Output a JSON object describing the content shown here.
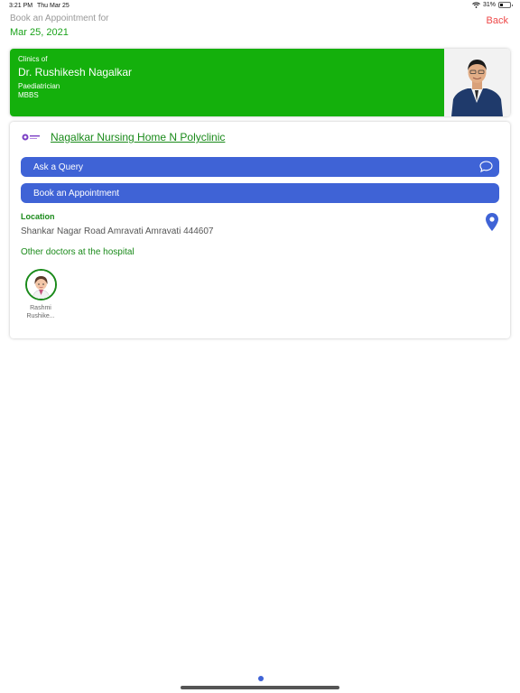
{
  "status_bar": {
    "time": "3:21 PM",
    "date": "Thu Mar 25",
    "battery": "31%",
    "battery_level": 0.31
  },
  "header": {
    "prompt": "Book an Appointment for",
    "date": "Mar 25, 2021",
    "back_label": "Back"
  },
  "doctor": {
    "clinics_of_label": "Clinics of",
    "name": "Dr. Rushikesh Nagalkar",
    "speciality": "Paediatrician",
    "degree": "MBBS"
  },
  "clinic": {
    "name": "Nagalkar Nursing Home N Polyclinic",
    "ask_query_label": "Ask a Query",
    "book_label": "Book an Appointment",
    "location_title": "Location",
    "address": "Shankar Nagar Road Amravati Amravati 444607",
    "other_doctors_title": "Other doctors at the hospital",
    "other_doctors": [
      {
        "name_line1": "Rashmi",
        "name_line2": "Rushike..."
      }
    ]
  },
  "colors": {
    "accent_green": "#14b00c",
    "button_blue": "#3f63d6",
    "back_red": "#ee4848"
  }
}
